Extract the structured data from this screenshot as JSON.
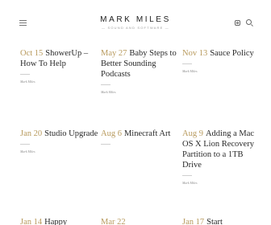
{
  "header": {
    "brand_title": "MARK MILES",
    "brand_subtitle": "— SOUND AND SOFTWARE —",
    "icons": [
      "menu-icon",
      "instagram-icon",
      "search-icon"
    ]
  },
  "posts": [
    {
      "date": "Oct 15",
      "title": "ShowerUp – How To Help",
      "author": "Mark Miles"
    },
    {
      "date": "May 27",
      "title": "Baby Steps to Better Sounding Podcasts",
      "author": "Mark Miles"
    },
    {
      "date": "Nov 13",
      "title": "Sauce Policy",
      "author": "Mark Miles"
    },
    {
      "date": "Jan 20",
      "title": "Studio Upgrade",
      "author": "Mark Miles"
    },
    {
      "date": "Aug 6",
      "title": "Minecraft Art",
      "author": ""
    },
    {
      "date": "Aug 9",
      "title": "Adding a Mac OS X Lion Recovery Partition to a 1TB Drive",
      "author": "Mark Miles"
    },
    {
      "date": "Jan 14",
      "title": "Happy",
      "author": ""
    },
    {
      "date": "Mar 22",
      "title": "",
      "author": ""
    },
    {
      "date": "Jan 17",
      "title": "Start",
      "author": ""
    }
  ]
}
